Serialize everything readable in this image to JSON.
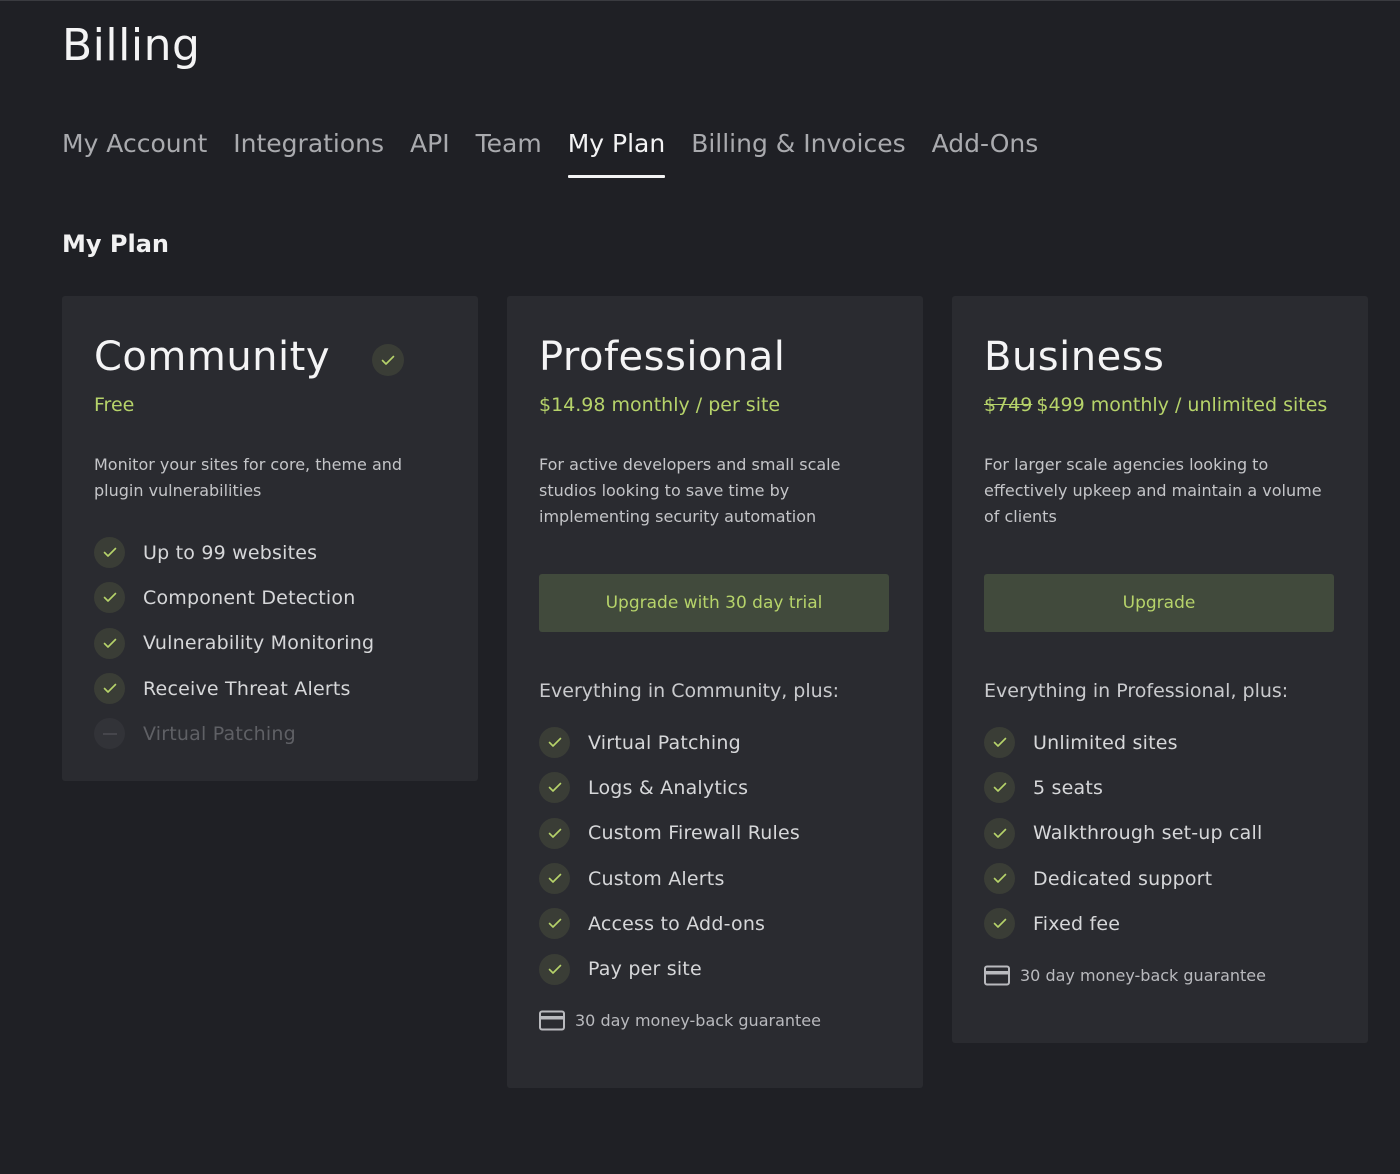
{
  "page": {
    "title": "Billing"
  },
  "tabs": [
    {
      "label": "My Account",
      "active": false
    },
    {
      "label": "Integrations",
      "active": false
    },
    {
      "label": "API",
      "active": false
    },
    {
      "label": "Team",
      "active": false
    },
    {
      "label": "My Plan",
      "active": true
    },
    {
      "label": "Billing & Invoices",
      "active": false
    },
    {
      "label": "Add-Ons",
      "active": false
    }
  ],
  "section": {
    "title": "My Plan"
  },
  "colors": {
    "accent": "#b6d36a",
    "background": "#1f2025",
    "card": "#2a2b30",
    "button": "#414a3c"
  },
  "plans": {
    "community": {
      "name": "Community",
      "current_icon": "check-icon",
      "price": "Free",
      "description": "Monitor your sites for core, theme and plugin vulnerabilities",
      "features": [
        {
          "label": "Up to 99 websites",
          "included": true
        },
        {
          "label": "Component Detection",
          "included": true
        },
        {
          "label": "Vulnerability Monitoring",
          "included": true
        },
        {
          "label": "Receive Threat Alerts",
          "included": true
        },
        {
          "label": "Virtual Patching",
          "included": false
        }
      ]
    },
    "professional": {
      "name": "Professional",
      "price": "$14.98 monthly / per site",
      "description": "For active developers and small scale studios looking to save time by implementing security automation",
      "button_label": "Upgrade with 30 day trial",
      "plus_heading": "Everything in Community, plus:",
      "features": [
        {
          "label": "Virtual Patching"
        },
        {
          "label": "Logs & Analytics"
        },
        {
          "label": "Custom Firewall Rules"
        },
        {
          "label": "Custom Alerts"
        },
        {
          "label": "Access to Add-ons"
        },
        {
          "label": "Pay per site"
        }
      ],
      "guarantee": "30 day money-back guarantee"
    },
    "business": {
      "name": "Business",
      "price_old": "$749",
      "price": "$499 monthly / unlimited sites",
      "description": "For larger scale agencies looking to effectively upkeep and maintain a volume of clients",
      "button_label": "Upgrade",
      "plus_heading": "Everything in Professional, plus:",
      "features": [
        {
          "label": "Unlimited sites"
        },
        {
          "label": "5 seats"
        },
        {
          "label": "Walkthrough set-up call"
        },
        {
          "label": "Dedicated support"
        },
        {
          "label": "Fixed fee"
        }
      ],
      "guarantee": "30 day money-back guarantee"
    }
  }
}
